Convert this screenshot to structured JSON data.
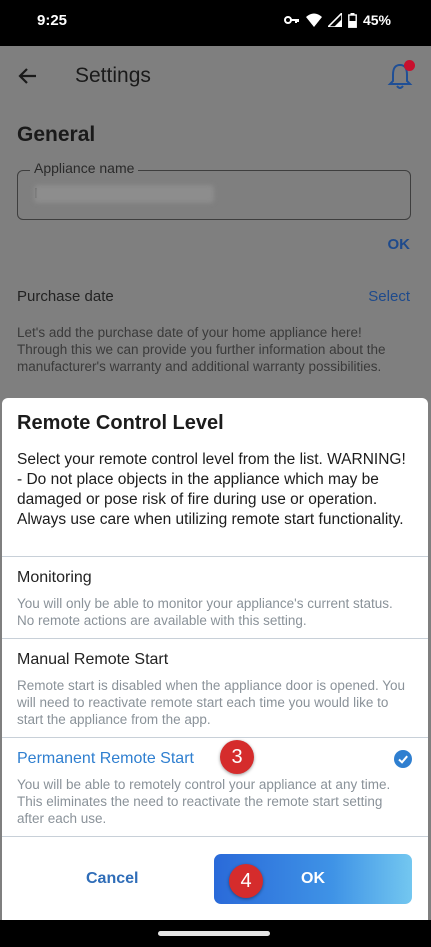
{
  "status_bar": {
    "time": "9:25",
    "battery": "45%"
  },
  "app": {
    "title": "Settings",
    "section": "General",
    "appliance_name_label": "Appliance name",
    "appliance_name_value": "I",
    "ok_label": "OK",
    "purchase_date_label": "Purchase date",
    "select_label": "Select",
    "purchase_desc": "Let's add the purchase date of your home appliance here! Through this we can provide you further information about the manufacturer's warranty and additional warranty possibilities."
  },
  "sheet": {
    "title": "Remote Control Level",
    "description": "Select your remote control level from the list. WARNING! - Do not place objects in the appliance which may be damaged or pose risk of fire during use or operation. Always use care when utilizing remote start functionality.",
    "options": [
      {
        "title": "Monitoring",
        "description": "You will only be able to monitor your appliance's current status. No remote actions are available with this setting.",
        "selected": false
      },
      {
        "title": "Manual Remote Start",
        "description": "Remote start is disabled when the appliance door is opened. You will need to reactivate remote start each time you would like to start the appliance from the app.",
        "selected": false
      },
      {
        "title": "Permanent Remote Start",
        "description": "You will be able to remotely control your appliance at any time. This eliminates the need to reactivate the remote start setting after each use.",
        "selected": true
      }
    ],
    "cancel_label": "Cancel",
    "ok_label": "OK"
  },
  "annotations": {
    "step3": "3",
    "step4": "4"
  },
  "colors": {
    "accent": "#2f7fd0",
    "badge": "#d52c2c",
    "scrim": "#7f7f7f"
  },
  "icons": [
    "back-arrow-icon",
    "notification-bell-icon",
    "key-icon",
    "wifi-icon",
    "signal-icon",
    "battery-icon",
    "checkmark-icon"
  ]
}
